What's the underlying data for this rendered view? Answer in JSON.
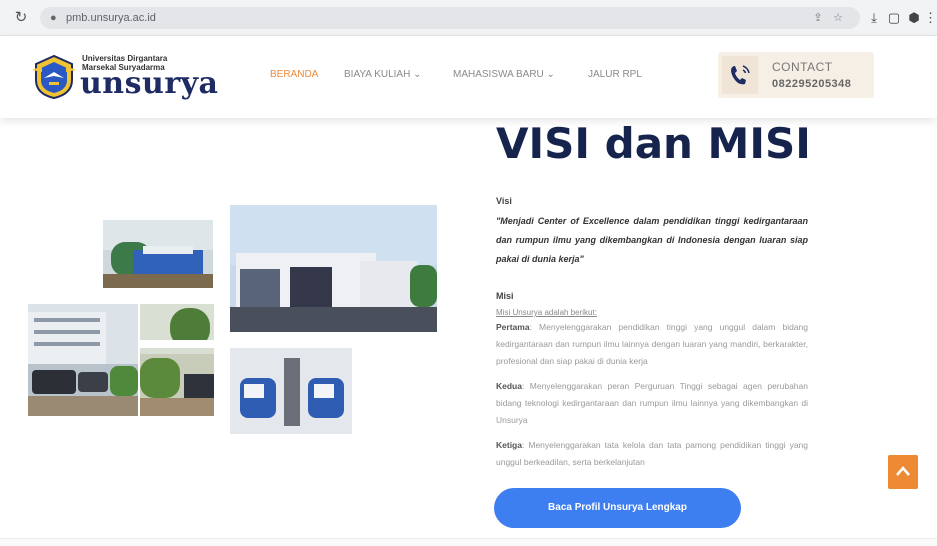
{
  "browser": {
    "url": "pmb.unsurya.ac.id"
  },
  "header": {
    "logo_line1": "Universitas Dirgantara",
    "logo_line2": "Marsekal Suryadarma",
    "logo_word": "unsurya",
    "nav": [
      {
        "label": "BERANDA",
        "active": true
      },
      {
        "label": "BIAYA KULIAH ⌄",
        "active": false
      },
      {
        "label": "MAHASISWA BARU ⌄",
        "active": false
      },
      {
        "label": "JALUR RPL",
        "active": false
      }
    ],
    "contact_label": "CONTACT",
    "contact_number": "082295205348"
  },
  "main": {
    "title": "VISI dan MISI",
    "visi_label": "Visi",
    "visi_text": "\"Menjadi Center of Excellence dalam pendidikan tinggi kedirgantaraan dan rumpun ilmu yang dikembangkan di Indonesia dengan luaran siap pakai di dunia kerja\"",
    "misi_label": "Misi",
    "misi_link": "Misi Unsurya adalah berikut:",
    "misi": [
      {
        "lead": "Pertama",
        "text": "Menyelenggarakan pendidikan tinggi yang unggul dalam bidang kedirgantaraan dan rumpun ilmu lainnya dengan luaran yang mandiri, berkarakter, profesional dan siap pakai di dunia kerja"
      },
      {
        "lead": "Kedua",
        "text": "Menyelenggarakan peran Perguruan Tinggi sebagai agen perubahan bidang teknologi kedirgantaraan dan rumpun ilmu lainnya yang dikembangkan di Unsurya"
      },
      {
        "lead": "Ketiga",
        "text": "Menyelenggarakan tata kelola dan tata pamong pendidikan tinggi yang unggul berkeadilan, serta berkelanjutan"
      }
    ],
    "cta_label": "Baca Profil Unsurya Lengkap"
  },
  "colors": {
    "accent_orange": "#f08a3c",
    "navy": "#15234d",
    "cta_blue": "#3d7ef0"
  },
  "icons": {
    "reload": "reload-icon",
    "lock": "lock-icon",
    "phone": "phone-icon",
    "scroll_top": "chevron-up-icon"
  }
}
